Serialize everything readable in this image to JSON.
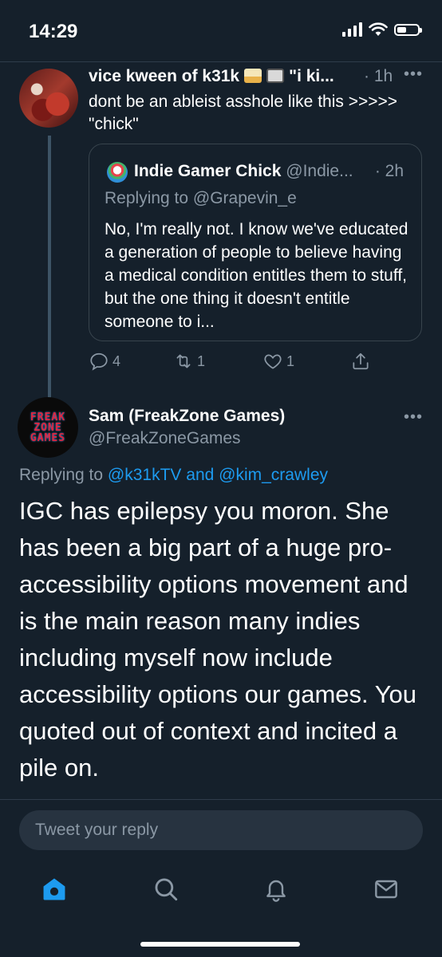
{
  "status_bar": {
    "time": "14:29"
  },
  "tweet1": {
    "name": "vice kween of k31k",
    "title_tail": "\"i ki...",
    "time": "· 1h",
    "text": "dont be an ableist asshole like this >>>>> \"chick\"",
    "quote": {
      "name": "Indie Gamer Chick",
      "handle": "@Indie...",
      "time": "· 2h",
      "replying": "Replying to @Grapevin_e",
      "text": "No, I'm really not. I know we've educated a generation of people to believe having a medical condition entitles them to stuff, but the one thing it doesn't entitle someone to i..."
    },
    "actions": {
      "replies": "4",
      "retweets": "1",
      "likes": "1"
    }
  },
  "tweet2": {
    "name": "Sam (FreakZone Games)",
    "handle": "@FreakZoneGames",
    "avatar_lines": [
      "FREAK",
      "ZONE",
      "GAMES"
    ],
    "replying_prefix": "Replying to",
    "replying_user1": "@k31kTV",
    "replying_and": "and",
    "replying_user2": "@kim_crawley",
    "body": "IGC has epilepsy you moron. She has been a big part of a huge pro-accessibility options movement and is the main reason many indies including myself now include accessibility options our games. You quoted out of context and incited a pile on."
  },
  "reply_box": {
    "placeholder": "Tweet your reply"
  },
  "colors": {
    "background": "#15202b",
    "accent": "#1d9bf0",
    "muted": "#8b98a5"
  }
}
